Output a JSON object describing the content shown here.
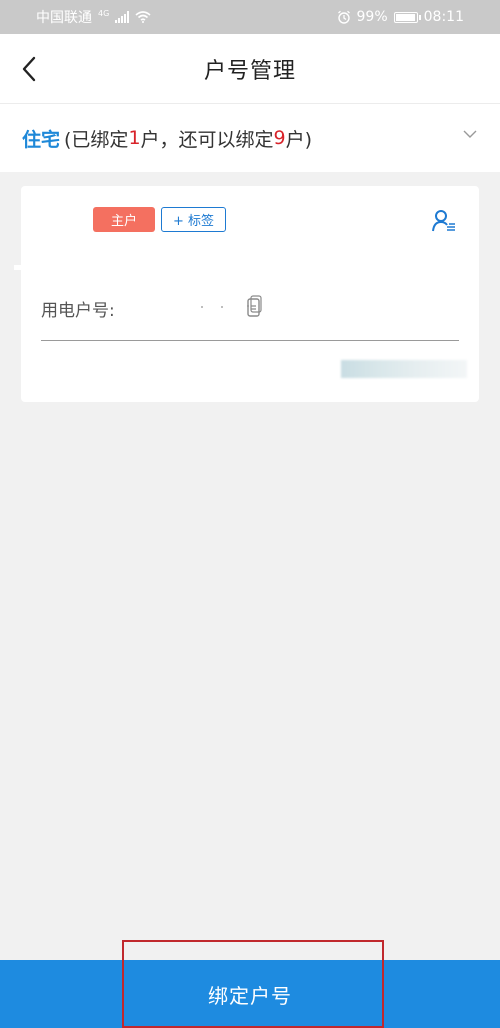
{
  "status_bar": {
    "carrier": "中国联通",
    "network": "4G",
    "battery": "99%",
    "battery_level": 0.99,
    "time": "08:11"
  },
  "header": {
    "title": "户号管理",
    "back_icon": "chevron-left-icon"
  },
  "account_type": {
    "name": "住宅",
    "text_prefix": "(已绑定",
    "bound_count": "1",
    "text_middle": "户，还可以绑定",
    "remaining_count": "9",
    "text_suffix": "户)",
    "expand_icon": "chevron-down-icon"
  },
  "card": {
    "primary_tag": "主户",
    "add_tag_label": "+ 标签",
    "account_label": "用电户号:",
    "user_icon": "user-manage-icon",
    "copy_icon": "copy-icon"
  },
  "footer": {
    "bind_button_label": "绑定户号"
  },
  "colors": {
    "accent": "#1e8be0",
    "primary_tag": "#f47060",
    "highlight": "#c0282d"
  }
}
